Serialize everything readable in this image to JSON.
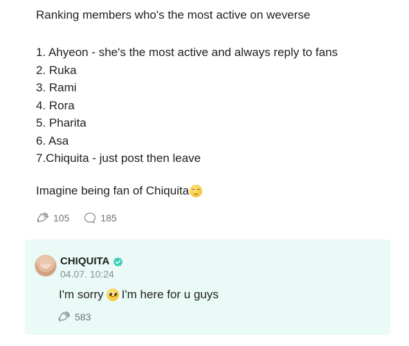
{
  "post": {
    "intro": "Ranking members who's the most active on weverse",
    "ranking": [
      "1. Ahyeon - she's the most active and always reply to fans",
      "2. Ruka",
      "3. Rami",
      "4. Rora",
      "5. Pharita",
      "6. Asa",
      "7.Chiquita - just post then leave"
    ],
    "closing": "Imagine being fan of Chiquita",
    "closing_emoji": "pensive-face-icon",
    "likes": "105",
    "comments": "185"
  },
  "reply": {
    "author": "CHIQUITA",
    "verified_color": "#3ecdb8",
    "date": "04.07. 10:24",
    "text_before": "I'm sorry",
    "text_emoji": "pleading-face-icon",
    "text_after": "I'm here for u guys",
    "likes": "583"
  },
  "colors": {
    "reply_background": "#eafaf6",
    "muted_text": "#8a8f97"
  }
}
